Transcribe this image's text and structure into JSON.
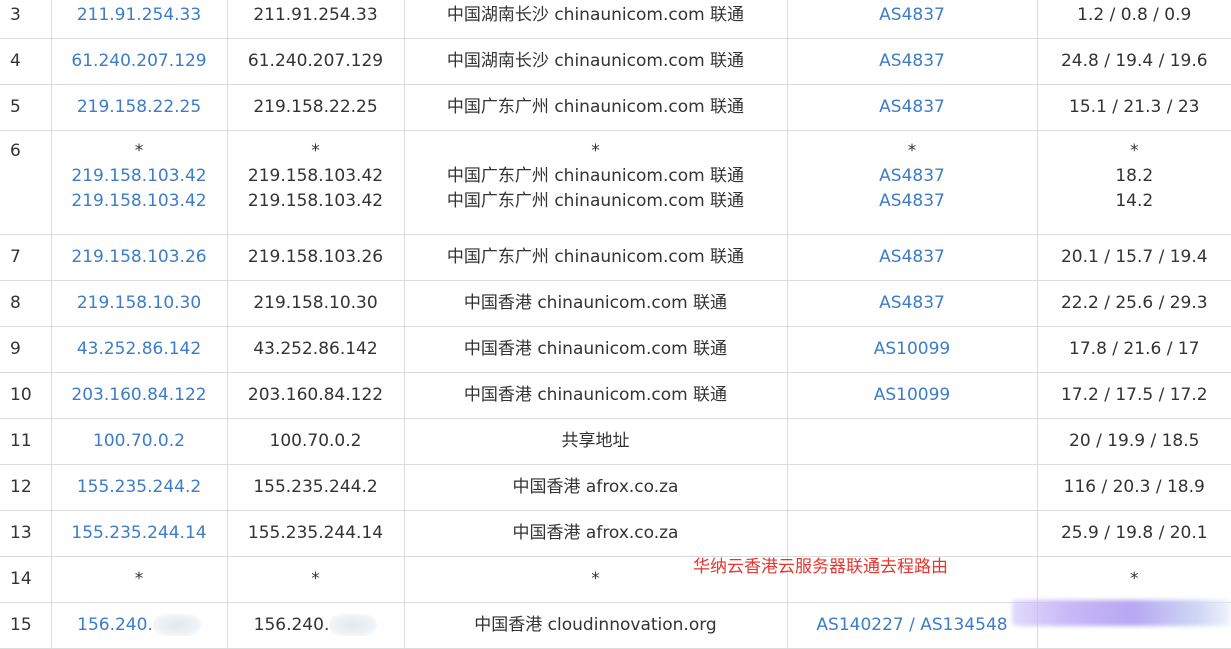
{
  "hops": [
    {
      "hop": "3",
      "ip": [
        "211.91.254.33"
      ],
      "host": [
        "211.91.254.33"
      ],
      "location": [
        "中国湖南长沙 chinaunicom.com 联通"
      ],
      "asn": [
        "AS4837"
      ],
      "latency": [
        "1.2 / 0.8 / 0.9"
      ]
    },
    {
      "hop": "4",
      "ip": [
        "61.240.207.129"
      ],
      "host": [
        "61.240.207.129"
      ],
      "location": [
        "中国湖南长沙 chinaunicom.com 联通"
      ],
      "asn": [
        "AS4837"
      ],
      "latency": [
        "24.8 / 19.4 / 19.6"
      ]
    },
    {
      "hop": "5",
      "ip": [
        "219.158.22.25"
      ],
      "host": [
        "219.158.22.25"
      ],
      "location": [
        "中国广东广州 chinaunicom.com 联通"
      ],
      "asn": [
        "AS4837"
      ],
      "latency": [
        "15.1 / 21.3 / 23"
      ]
    },
    {
      "hop": "6",
      "ip": [
        "*",
        "219.158.103.42",
        "219.158.103.42"
      ],
      "host": [
        "*",
        "219.158.103.42",
        "219.158.103.42"
      ],
      "location": [
        "*",
        "中国广东广州 chinaunicom.com 联通",
        "中国广东广州 chinaunicom.com 联通"
      ],
      "asn": [
        "*",
        "AS4837",
        "AS4837"
      ],
      "latency": [
        "*",
        "18.2",
        "14.2"
      ]
    },
    {
      "hop": "7",
      "ip": [
        "219.158.103.26"
      ],
      "host": [
        "219.158.103.26"
      ],
      "location": [
        "中国广东广州 chinaunicom.com 联通"
      ],
      "asn": [
        "AS4837"
      ],
      "latency": [
        "20.1 / 15.7 / 19.4"
      ]
    },
    {
      "hop": "8",
      "ip": [
        "219.158.10.30"
      ],
      "host": [
        "219.158.10.30"
      ],
      "location": [
        "中国香港 chinaunicom.com 联通"
      ],
      "asn": [
        "AS4837"
      ],
      "latency": [
        "22.2 / 25.6 / 29.3"
      ]
    },
    {
      "hop": "9",
      "ip": [
        "43.252.86.142"
      ],
      "host": [
        "43.252.86.142"
      ],
      "location": [
        "中国香港 chinaunicom.com 联通"
      ],
      "asn": [
        "AS10099"
      ],
      "latency": [
        "17.8 / 21.6 / 17"
      ]
    },
    {
      "hop": "10",
      "ip": [
        "203.160.84.122"
      ],
      "host": [
        "203.160.84.122"
      ],
      "location": [
        "中国香港 chinaunicom.com 联通"
      ],
      "asn": [
        "AS10099"
      ],
      "latency": [
        "17.2 / 17.5 / 17.2"
      ]
    },
    {
      "hop": "11",
      "ip": [
        "100.70.0.2"
      ],
      "host": [
        "100.70.0.2"
      ],
      "location": [
        "共享地址"
      ],
      "asn": [
        ""
      ],
      "latency": [
        "20 / 19.9 / 18.5"
      ]
    },
    {
      "hop": "12",
      "ip": [
        "155.235.244.2"
      ],
      "host": [
        "155.235.244.2"
      ],
      "location": [
        "中国香港 afrox.co.za"
      ],
      "asn": [
        ""
      ],
      "latency": [
        "116 / 20.3 / 18.9"
      ]
    },
    {
      "hop": "13",
      "ip": [
        "155.235.244.14"
      ],
      "host": [
        "155.235.244.14"
      ],
      "location": [
        "中国香港 afrox.co.za"
      ],
      "asn": [
        ""
      ],
      "latency": [
        "25.9 / 19.8 / 20.1"
      ]
    },
    {
      "hop": "14",
      "ip": [
        "*"
      ],
      "host": [
        "*"
      ],
      "location": [
        "*"
      ],
      "asn": [
        ""
      ],
      "latency": [
        "*"
      ]
    },
    {
      "hop": "15",
      "ip": [
        "156.240."
      ],
      "host": [
        "156.240."
      ],
      "location": [
        "中国香港 cloudinnovation.org"
      ],
      "asn": [
        "AS140227 / AS134548"
      ],
      "latency": [
        ""
      ]
    }
  ],
  "watermark": "华纳云香港云服务器联通去程路由",
  "colors": {
    "link": "#3c7cc8",
    "text": "#333333",
    "border": "#dcdcdc",
    "watermark": "#e8352e"
  }
}
